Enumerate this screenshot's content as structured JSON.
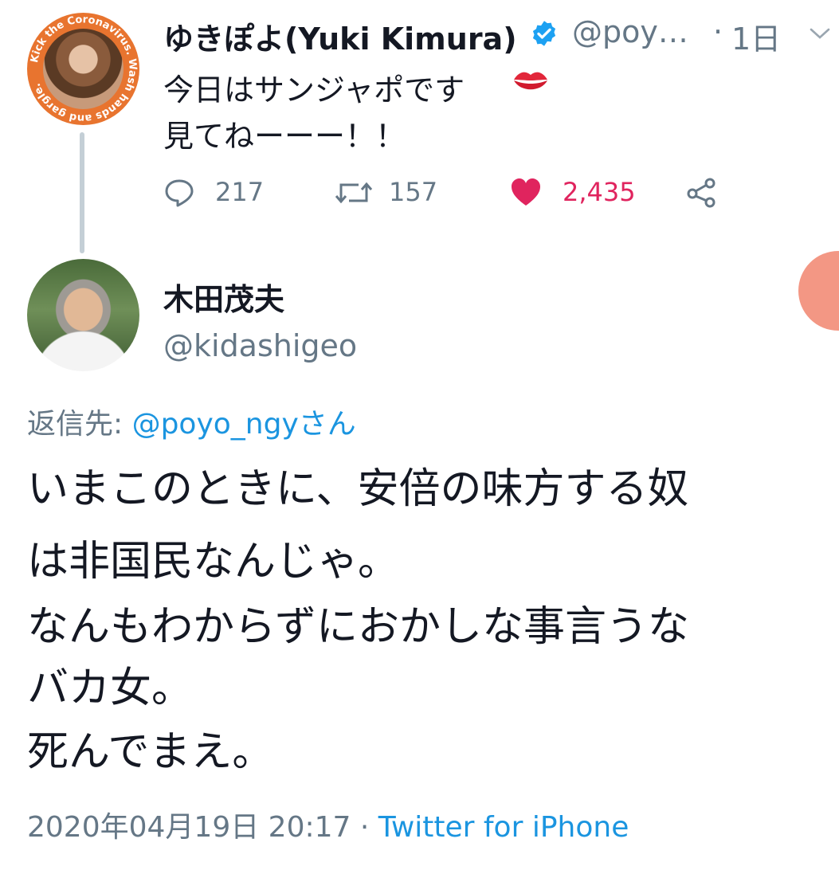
{
  "top_tweet": {
    "author_name": "ゆきぽよ(Yuki Kimura)",
    "handle": "@poy…",
    "separator": "·",
    "time": "1日",
    "text_lines": [
      "今日はサンジャポです",
      "見てねーーー！！"
    ],
    "emoji": "kiss-lips-icon",
    "avatar_ring_text": "Kick the Coronavirus. Wash hands and gargle.",
    "actions": {
      "replies": "217",
      "retweets": "157",
      "likes": "2,435"
    },
    "colors": {
      "like": "#e0245e",
      "verified": "#1da1f2",
      "ring": "#e8742f"
    }
  },
  "reply_tweet": {
    "author_name": "木田茂夫",
    "handle": "@kidashigeo",
    "replying_to_label": "返信先: ",
    "replying_to_handle": "@poyo_ngyさん",
    "text_lines": [
      "いまこのときに、安倍の味方する奴",
      "は非国民なんじゃ。",
      "なんもわからずにおかしな事言うな",
      "バカ女。",
      "死んでまえ。"
    ],
    "timestamp": "2020年04月19日 20:17",
    "separator": " · ",
    "source": "Twitter for iPhone",
    "colors": {
      "link": "#1b95e0",
      "meta": "#657786"
    }
  }
}
